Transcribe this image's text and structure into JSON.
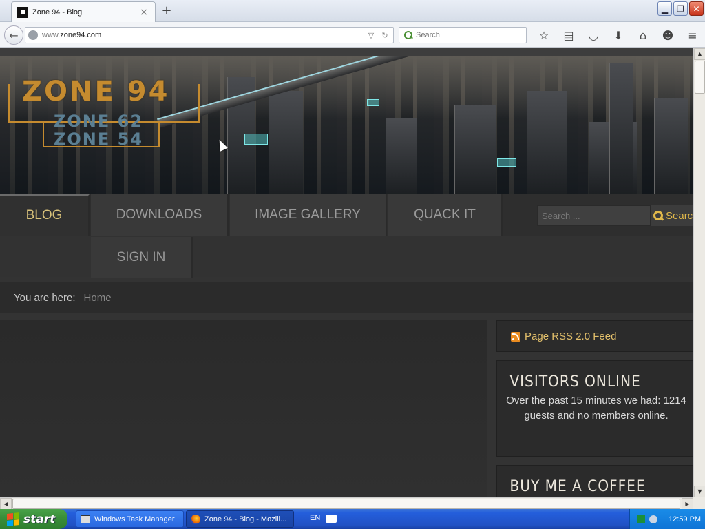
{
  "browser": {
    "tab_title": "Zone 94 - Blog",
    "tab_close": "×",
    "new_tab": "+",
    "url_prefix": "www.",
    "url_domain": "zone94.com",
    "search_placeholder": "Search",
    "toolbar_icons": [
      "star-icon",
      "reading-list-icon",
      "pocket-icon",
      "download-icon",
      "home-icon",
      "chat-icon",
      "menu-icon"
    ]
  },
  "site": {
    "logo_main": "ZONE 94",
    "logo_sub1": "ZONE 62",
    "logo_sub2": "ZONE 54",
    "menu": {
      "blog": "BLOG",
      "downloads": "DOWNLOADS",
      "gallery": "IMAGE GALLERY",
      "quack": "QUACK IT",
      "signin": "SIGN IN"
    },
    "search_placeholder": "Search ...",
    "search_button": "Search",
    "breadcrumb_label": "You are here:",
    "breadcrumb_home": "Home",
    "rss_label": "Page RSS 2.0 Feed",
    "visitors_title": "VISITORS ONLINE",
    "visitors_text": "Over the past 15 minutes we had: 1214 guests and no members online.",
    "coffee_title": "BUY ME A COFFEE"
  },
  "taskbar": {
    "start": "start",
    "task_manager": "Windows Task Manager",
    "firefox": "Zone 94 - Blog - Mozill...",
    "lang": "EN",
    "clock": "12:59 PM"
  },
  "colors": {
    "accent_gold": "#d9c27a",
    "rss_gold": "#e3c06b",
    "logo_orange": "#c58b2f",
    "logo_blue": "#5b7f93"
  }
}
